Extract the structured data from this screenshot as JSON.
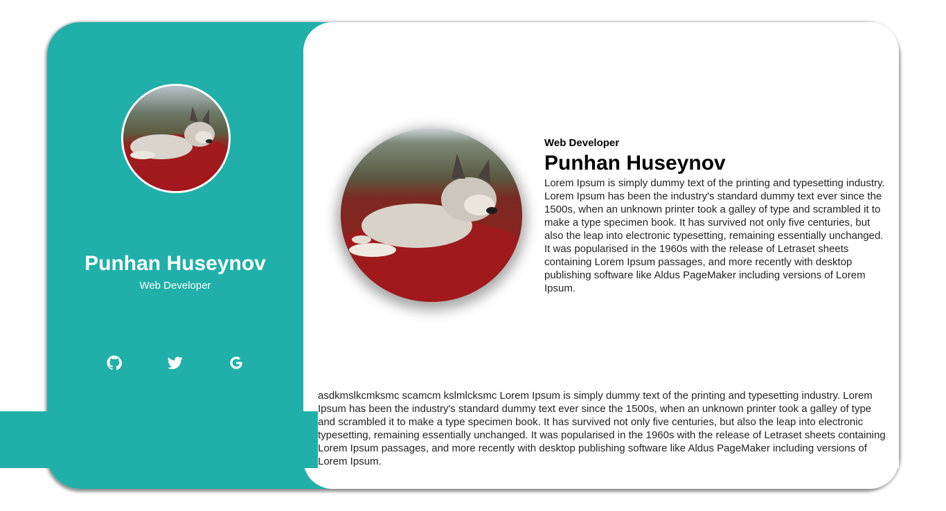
{
  "profile": {
    "name": "Punhan Huseynov",
    "role": "Web Developer",
    "avatar_alt": "Husky lying in red field"
  },
  "main": {
    "role": "Web Developer",
    "name": "Punhan Huseynov",
    "bio": "Lorem Ipsum is simply dummy text of the printing and typesetting industry. Lorem Ipsum has been the industry's standard dummy text ever since the 1500s, when an unknown printer took a galley of type and scrambled it to make a type specimen book. It has survived not only five centuries, but also the leap into electronic typesetting, remaining essentially unchanged. It was popularised in the 1960s with the release of Letraset sheets containing Lorem Ipsum passages, and more recently with desktop publishing software like Aldus PageMaker including versions of Lorem Ipsum."
  },
  "footer_text": "asdkmslkcmksmc scamcm kslmlcksmc Lorem Ipsum is simply dummy text of the printing and typesetting industry. Lorem Ipsum has been the industry's standard dummy text ever since the 1500s, when an unknown printer took a galley of type and scrambled it to make a type specimen book. It has survived not only five centuries, but also the leap into electronic typesetting, remaining essentially unchanged. It was popularised in the 1960s with the release of Letraset sheets containing Lorem Ipsum passages, and more recently with desktop publishing software like Aldus PageMaker including versions of Lorem Ipsum.",
  "socials": [
    {
      "icon": "github-icon"
    },
    {
      "icon": "twitter-icon"
    },
    {
      "icon": "google-icon"
    }
  ],
  "colors": {
    "accent": "#20b0a9",
    "text": "#222222",
    "white": "#ffffff"
  }
}
